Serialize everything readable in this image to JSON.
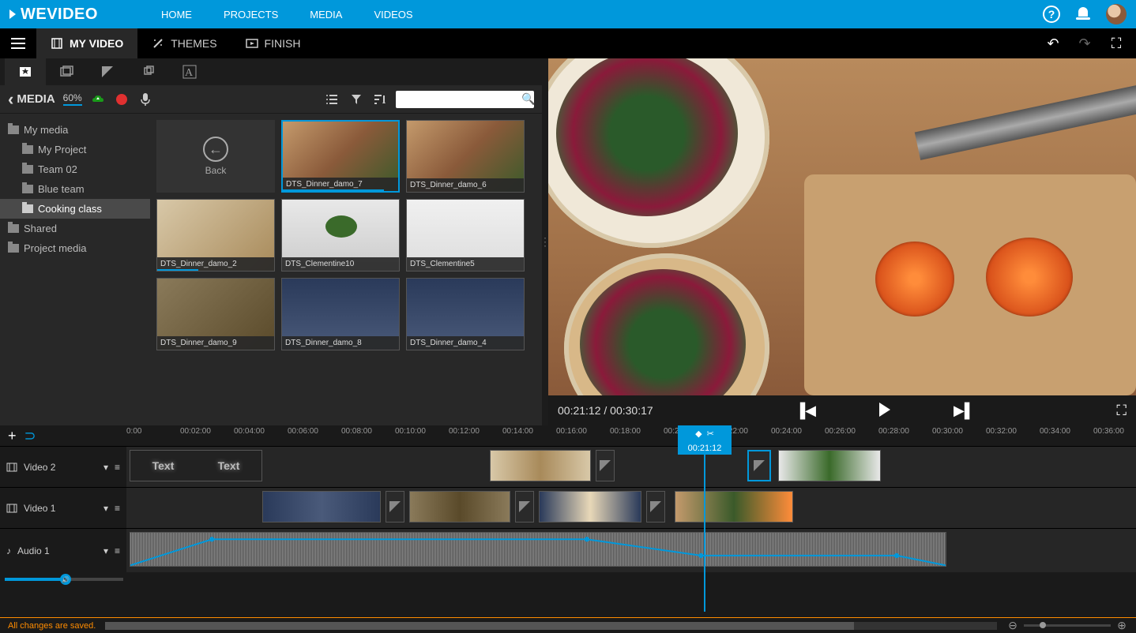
{
  "top": {
    "logo": "WEVIDEO",
    "nav": [
      "HOME",
      "PROJECTS",
      "MEDIA",
      "VIDEOS"
    ]
  },
  "editor_tabs": {
    "my_video": "MY VIDEO",
    "themes": "THEMES",
    "finish": "FINISH"
  },
  "media": {
    "title": "MEDIA",
    "usage": "60%",
    "back_label": "Back",
    "folders": {
      "my_media": "My media",
      "my_project": "My Project",
      "team02": "Team 02",
      "blue_team": "Blue team",
      "cooking_class": "Cooking class",
      "shared": "Shared",
      "project_media": "Project media"
    },
    "clips": [
      {
        "label": "DTS_Dinner_damo_7",
        "bar": 88,
        "sel": true
      },
      {
        "label": "DTS_Dinner_damo_6",
        "bar": 0
      },
      {
        "label": "DTS_Dinner_damo_2",
        "bar": 35
      },
      {
        "label": "DTS_Clementine10",
        "bar": 0
      },
      {
        "label": "DTS_Clementine5",
        "bar": 0
      },
      {
        "label": "DTS_Dinner_damo_9",
        "bar": 0
      },
      {
        "label": "DTS_Dinner_damo_8",
        "bar": 0
      },
      {
        "label": "DTS_Dinner_damo_4",
        "bar": 0
      }
    ]
  },
  "preview": {
    "current": "00:21:12",
    "total": "00:30:17"
  },
  "timeline": {
    "playhead": "00:21:12",
    "ticks": [
      "0:00",
      "00:02:00",
      "00:04:00",
      "00:06:00",
      "00:08:00",
      "00:10:00",
      "00:12:00",
      "00:14:00",
      "00:16:00",
      "00:18:00",
      "00:20:00",
      "00:22:00",
      "00:24:00",
      "00:26:00",
      "00:28:00",
      "00:30:00",
      "00:32:00",
      "00:34:00",
      "00:36:00"
    ],
    "tracks": {
      "video2": "Video 2",
      "video1": "Video 1",
      "audio1": "Audio 1"
    },
    "text_clip": "Text"
  },
  "status": "All changes are saved."
}
